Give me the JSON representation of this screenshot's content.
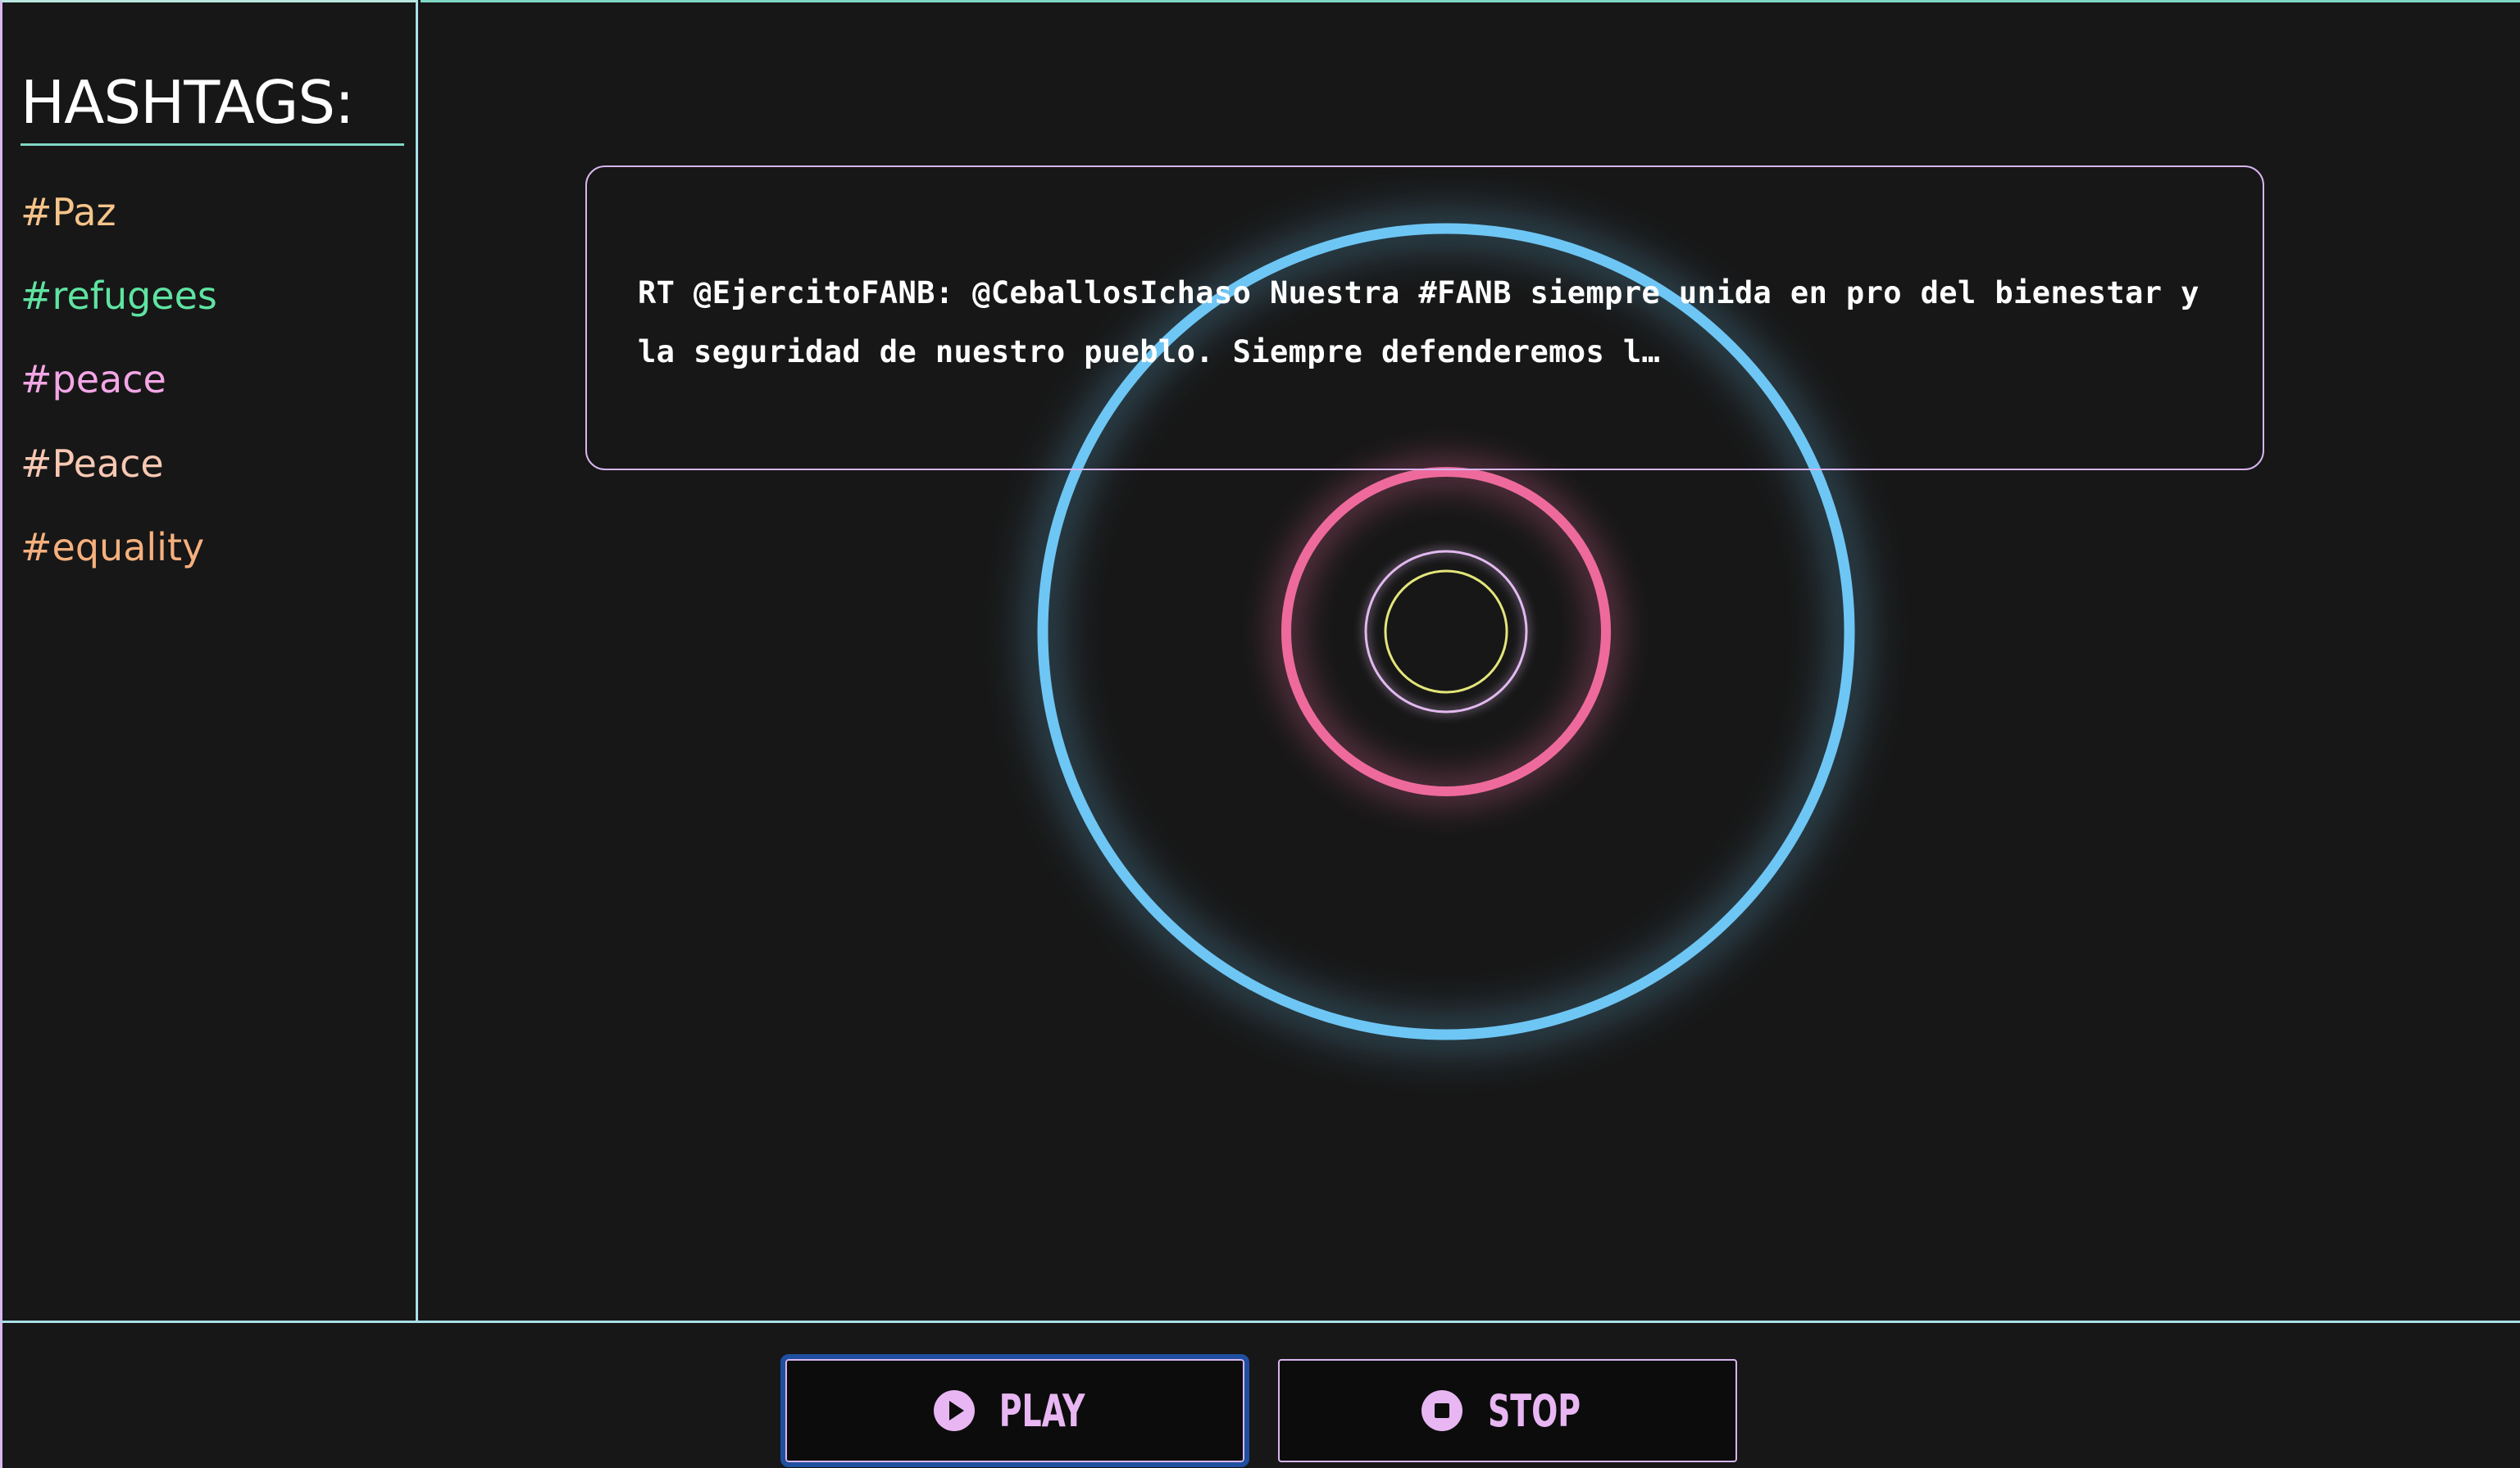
{
  "sidebar": {
    "title": "HASHTAGS:",
    "tags": [
      {
        "label": "#Paz",
        "color": "#f6c48a"
      },
      {
        "label": "#refugees",
        "color": "#5fe3a1"
      },
      {
        "label": "#peace",
        "color": "#f3a6e6"
      },
      {
        "label": "#Peace",
        "color": "#f8c8b3"
      },
      {
        "label": "#equality",
        "color": "#f6b07d"
      }
    ]
  },
  "tweet": {
    "text": "RT @EjercitoFANB: @CeballosIchaso Nuestra #FANB siempre unida en pro del bienestar y la seguridad de nuestro pueblo. Siempre defenderemos l…"
  },
  "visual": {
    "rings": [
      {
        "name": "outer-ring",
        "color": "#6ec6f4"
      },
      {
        "name": "middle-ring",
        "color": "#ef6a9c"
      },
      {
        "name": "inner-ring",
        "color": "#e2b9f0"
      },
      {
        "name": "core-ring",
        "color": "#e3e67a"
      }
    ]
  },
  "controls": {
    "play_label": "PLAY",
    "stop_label": "STOP",
    "play_icon": "play-circle-icon",
    "stop_icon": "stop-circle-icon",
    "accent": "#e8b6f2"
  }
}
